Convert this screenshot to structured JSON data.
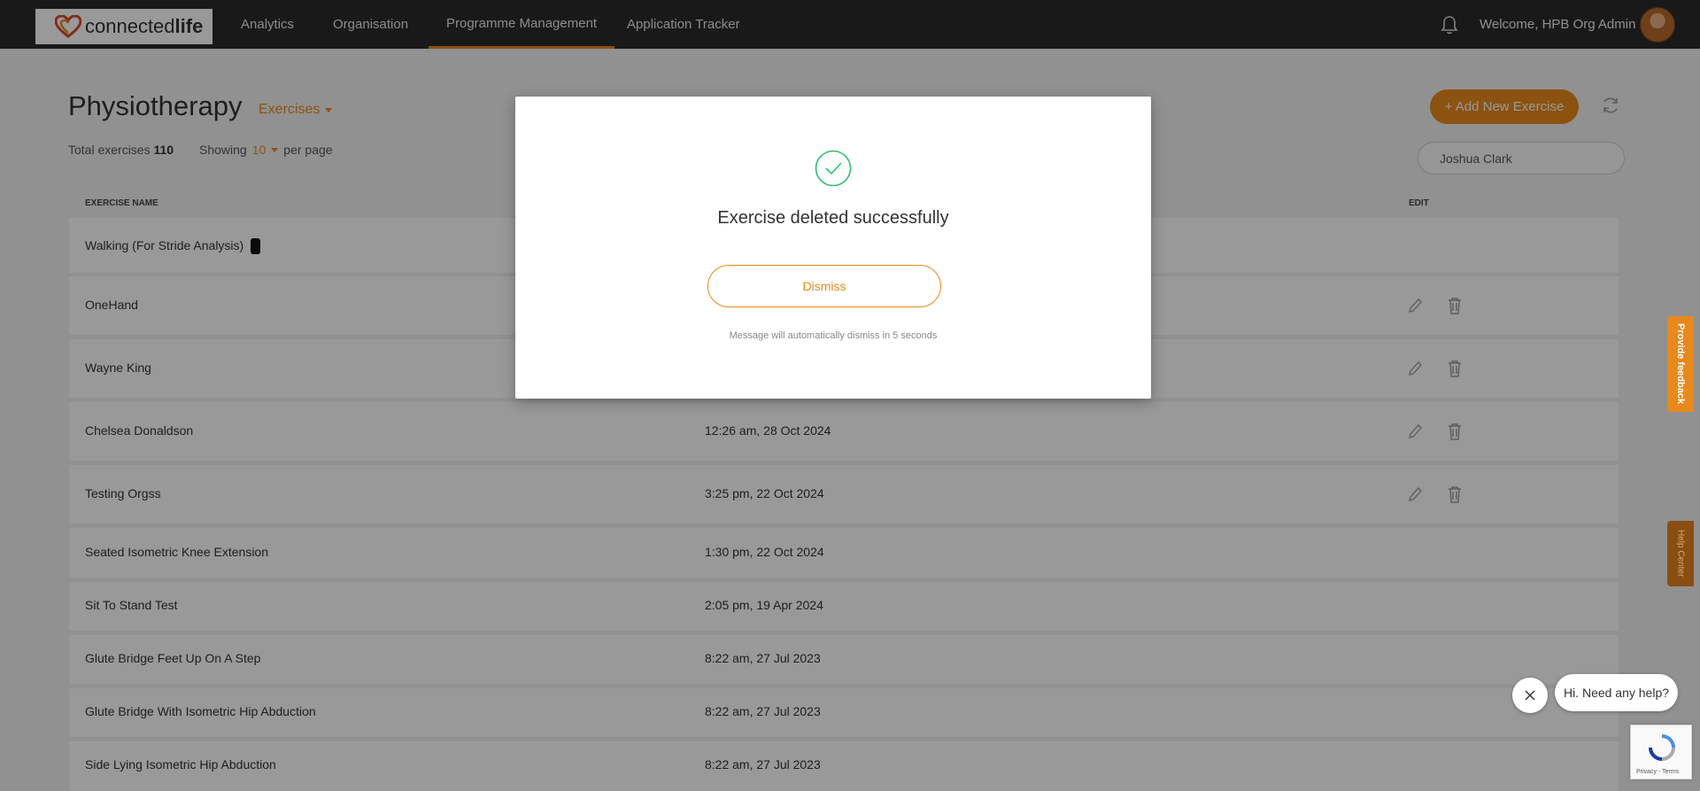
{
  "brand": {
    "part1": "connected",
    "part2": "life"
  },
  "nav": {
    "items": [
      {
        "label": "Analytics"
      },
      {
        "label": "Organisation"
      },
      {
        "label": "Programme Management"
      },
      {
        "label": "Application Tracker"
      }
    ],
    "active_index": 2,
    "welcome": "Welcome, HPB Org Admin"
  },
  "page": {
    "title": "Physiotherapy",
    "section_dropdown": "Exercises",
    "total_label": "Total exercises",
    "total_value": "110",
    "showing_label": "Showing",
    "per_page_value": "10",
    "per_page_label": "per page",
    "add_button": "+ Add New Exercise",
    "search_value": "Joshua Clark"
  },
  "table": {
    "columns": {
      "name": "EXERCISE NAME",
      "edit": "EDIT"
    },
    "rows": [
      {
        "name": "Walking (For Stride Analysis)",
        "date": "",
        "editable": false,
        "device": true
      },
      {
        "name": "OneHand",
        "date": "",
        "editable": true
      },
      {
        "name": "Wayne King",
        "date": "",
        "editable": true
      },
      {
        "name": "Chelsea Donaldson",
        "date": "12:26 am, 28 Oct 2024",
        "editable": true
      },
      {
        "name": "Testing Orgss",
        "date": "3:25 pm, 22 Oct 2024",
        "editable": true
      },
      {
        "name": "Seated Isometric Knee Extension",
        "date": "1:30 pm, 22 Oct 2024",
        "editable": false
      },
      {
        "name": "Sit To Stand Test",
        "date": "2:05 pm, 19 Apr 2024",
        "editable": false
      },
      {
        "name": "Glute Bridge Feet Up On A Step",
        "date": "8:22 am, 27 Jul 2023",
        "editable": false
      },
      {
        "name": "Glute Bridge With Isometric Hip Abduction",
        "date": "8:22 am, 27 Jul 2023",
        "editable": false
      },
      {
        "name": "Side Lying Isometric Hip Abduction",
        "date": "8:22 am, 27 Jul 2023",
        "editable": false
      }
    ]
  },
  "modal": {
    "icon": "check-circle-icon",
    "message": "Exercise deleted successfully",
    "dismiss_label": "Dismiss",
    "auto_dismiss_text": "Message will automatically dismiss in 5 seconds"
  },
  "side_tabs": {
    "feedback": "Provide feedback",
    "help": "Help Center"
  },
  "chat": {
    "prompt": "Hi. Need any help?"
  },
  "recaptcha": {
    "text": "Privacy - Terms"
  },
  "colors": {
    "accent": "#e8891c",
    "nav_bg": "#2b2b2b",
    "success": "#2fbf71"
  }
}
